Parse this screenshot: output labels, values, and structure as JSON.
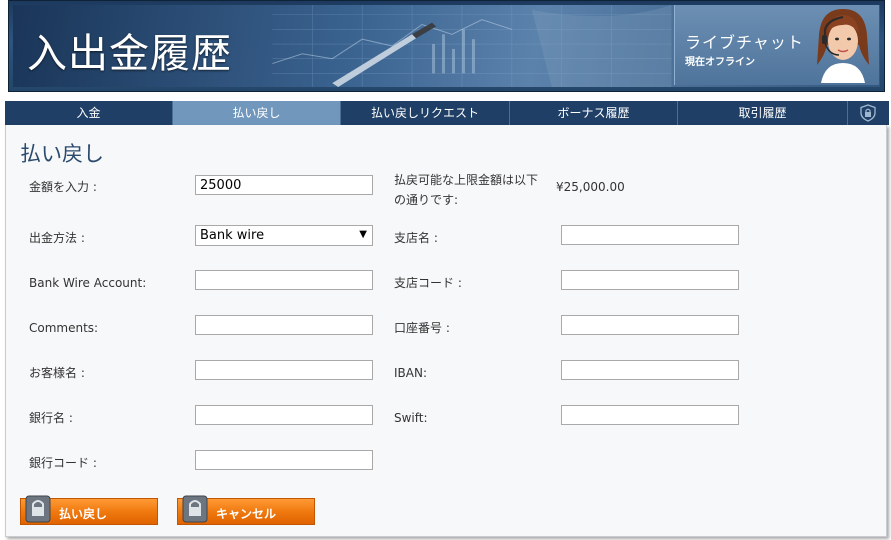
{
  "header": {
    "title": "入出金履歴",
    "live_chat": {
      "title": "ライブチャット",
      "status": "現在オフライン"
    }
  },
  "tabs": [
    {
      "label": "入金",
      "active": false
    },
    {
      "label": "払い戻し",
      "active": true
    },
    {
      "label": "払い戻しリクエスト",
      "active": false
    },
    {
      "label": "ボーナス履歴",
      "active": false
    },
    {
      "label": "取引履歴",
      "active": false
    }
  ],
  "form": {
    "section_title": "払い戻し",
    "amount_label": "金額を入力 :",
    "amount_value": "25000",
    "limit_label_line1": "払戻可能な上限金額は以下",
    "limit_label_line2": "の通りです:",
    "limit_value": "¥25,000.00",
    "method_label": "出金方法 :",
    "method_value": "Bank wire",
    "bank_wire_account_label": "Bank Wire Account:",
    "comments_label": "Comments:",
    "customer_name_label": "お客様名 :",
    "bank_name_label": "銀行名 :",
    "bank_code_label": "銀行コード :",
    "branch_name_label": "支店名 :",
    "branch_code_label": "支店コード :",
    "account_number_label": "口座番号 :",
    "iban_label": "IBAN:",
    "swift_label": "Swift:"
  },
  "buttons": {
    "withdraw": "払い戻し",
    "cancel": "キャンセル"
  },
  "colors": {
    "tab_bg": "#1f3f66",
    "tab_active": "#7197bd",
    "button_orange": "#f07a10"
  }
}
